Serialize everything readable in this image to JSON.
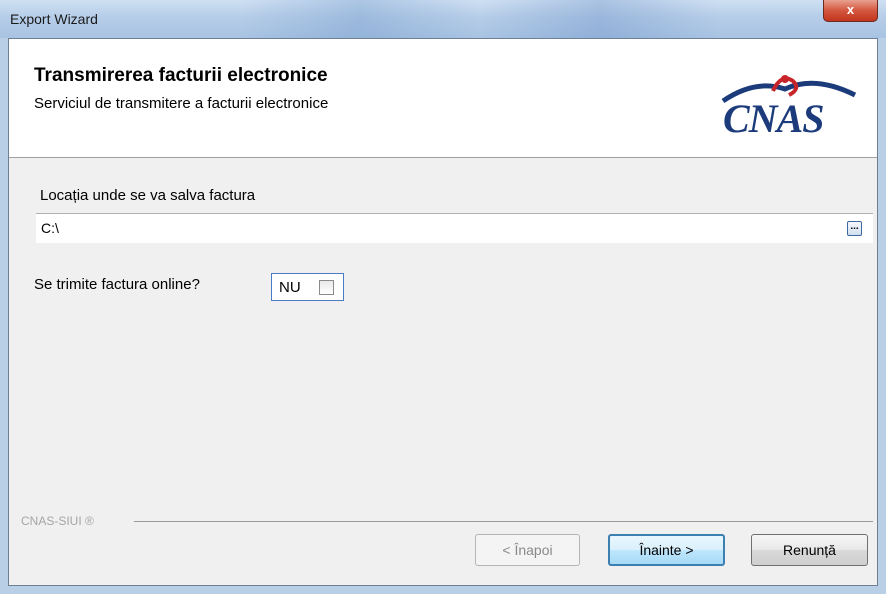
{
  "window": {
    "title": "Export Wizard",
    "close_glyph": "x"
  },
  "header": {
    "title": "Transmirerea facturii electronice",
    "subtitle": "Serviciul de transmitere a facturii electronice",
    "logo_text": "CNAS"
  },
  "form": {
    "location_label": "Locația unde se va salva factura",
    "location_value": "C:\\",
    "browse_label": "...",
    "online_label": "Se trimite factura online?",
    "online_value": "NU",
    "online_checked": false
  },
  "footer": {
    "brand": "CNAS-SIUI ®"
  },
  "buttons": {
    "back": "< Înapoi",
    "next": "Înainte >",
    "cancel": "Renunță"
  },
  "colors": {
    "logo_blue": "#1c3b7a",
    "logo_red": "#c8252b",
    "close_red": "#c2351d",
    "focus_blue": "#3c7fb1"
  }
}
